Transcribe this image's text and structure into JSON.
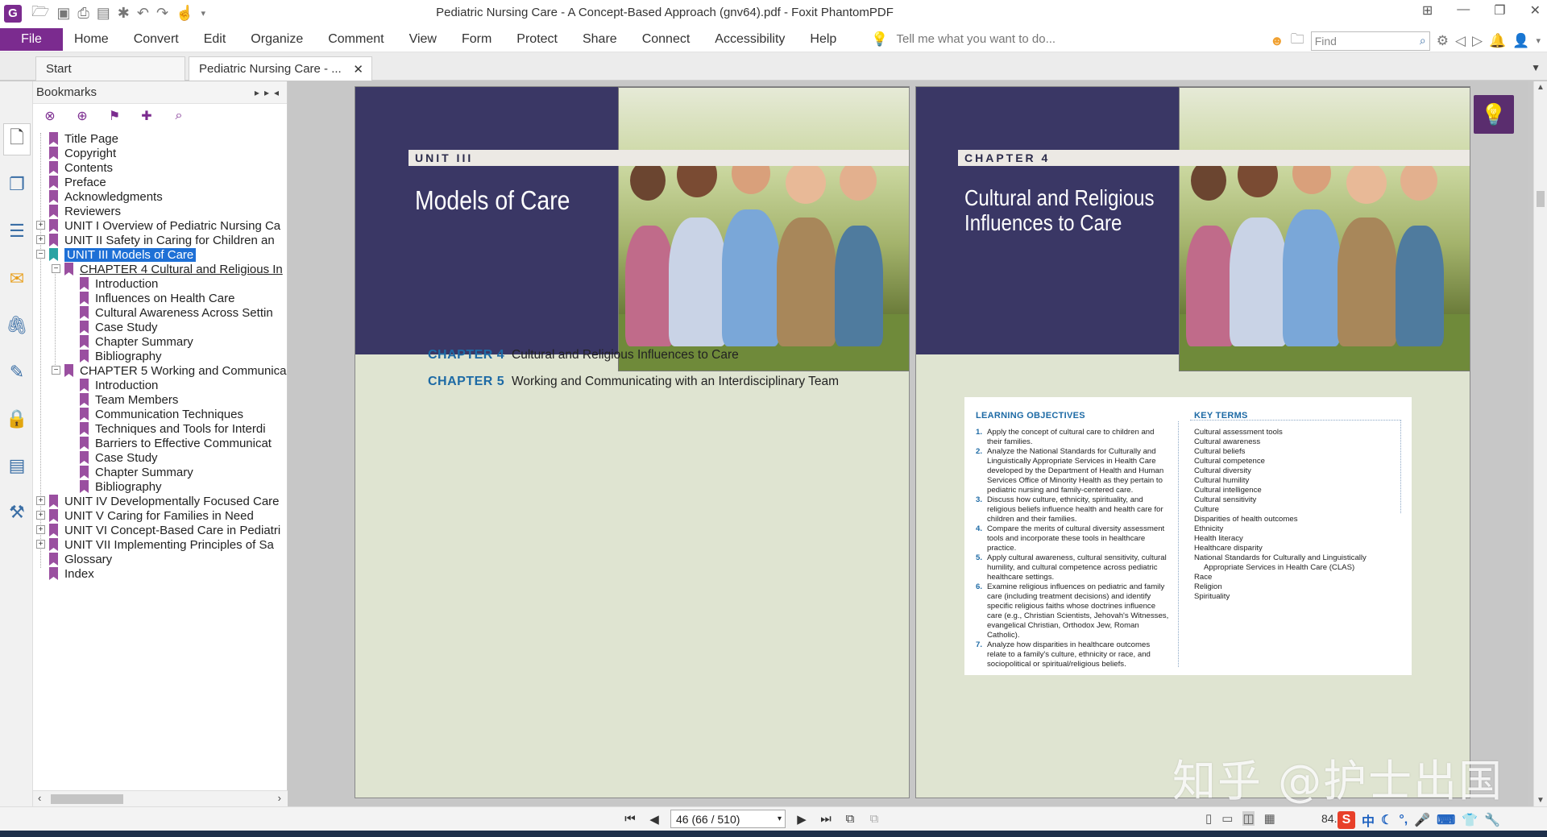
{
  "window": {
    "title": "Pediatric Nursing Care - A Concept-Based Approach (gnv64).pdf - Foxit PhantomPDF"
  },
  "menu": {
    "file": "File",
    "items": [
      "Home",
      "Convert",
      "Edit",
      "Organize",
      "Comment",
      "View",
      "Form",
      "Protect",
      "Share",
      "Connect",
      "Accessibility",
      "Help"
    ],
    "tell_me": "Tell me what you want to do...",
    "find_placeholder": "Find"
  },
  "tabs": [
    {
      "label": "Start"
    },
    {
      "label": "Pediatric Nursing Care - ..."
    }
  ],
  "bookmarks": {
    "header": "Bookmarks",
    "items": [
      {
        "label": "Title Page"
      },
      {
        "label": "Copyright"
      },
      {
        "label": "Contents"
      },
      {
        "label": "Preface"
      },
      {
        "label": "Acknowledgments"
      },
      {
        "label": "Reviewers"
      },
      {
        "label": "UNIT I Overview of Pediatric Nursing Ca"
      },
      {
        "label": "UNIT II Safety in Caring for Children an"
      },
      {
        "label": "UNIT III Models of Care"
      },
      {
        "label": "CHAPTER 4 Cultural and Religious In"
      },
      {
        "label": "Introduction"
      },
      {
        "label": "Influences on Health Care"
      },
      {
        "label": "Cultural Awareness Across Settin"
      },
      {
        "label": "Case Study"
      },
      {
        "label": "Chapter Summary"
      },
      {
        "label": "Bibliography"
      },
      {
        "label": "CHAPTER 5 Working and Communica"
      },
      {
        "label": "Introduction"
      },
      {
        "label": "Team Members"
      },
      {
        "label": "Communication Techniques"
      },
      {
        "label": "Techniques and Tools for Interdi"
      },
      {
        "label": "Barriers to Effective Communicat"
      },
      {
        "label": "Case Study"
      },
      {
        "label": "Chapter Summary"
      },
      {
        "label": "Bibliography"
      },
      {
        "label": "UNIT IV Developmentally Focused Care"
      },
      {
        "label": "UNIT V Caring for Families in Need"
      },
      {
        "label": "UNIT VI Concept-Based Care in Pediatri"
      },
      {
        "label": "UNIT VII Implementing Principles of Sa"
      },
      {
        "label": "Glossary"
      },
      {
        "label": "Index"
      }
    ]
  },
  "left_page": {
    "unit_label": "UNIT III",
    "title": "Models of Care",
    "toc": [
      {
        "chapter": "CHAPTER 4",
        "title": "Cultural and Religious Influences to Care"
      },
      {
        "chapter": "CHAPTER 5",
        "title": "Working and Communicating with an Interdisciplinary Team"
      }
    ]
  },
  "right_page": {
    "chapter_label": "CHAPTER 4",
    "title_line1": "Cultural and Religious",
    "title_line2": "Influences to Care",
    "learning_objectives_title": "LEARNING OBJECTIVES",
    "learning_objectives": [
      {
        "num": "1.",
        "text": "Apply the concept of cultural care to children and their families."
      },
      {
        "num": "2.",
        "text": "Analyze the National Standards for Culturally and Linguistically Appropriate Services in Health Care developed by the Department of Health and Human Services Office of Minority Health as they pertain to pediatric nursing and family-centered care."
      },
      {
        "num": "3.",
        "text": "Discuss how culture, ethnicity, spirituality, and religious beliefs influence health and health care for children and their families."
      },
      {
        "num": "4.",
        "text": "Compare the merits of cultural diversity assessment tools and incorporate these tools in healthcare practice."
      },
      {
        "num": "5.",
        "text": "Apply cultural awareness, cultural sensitivity, cultural humility, and cultural competence across pediatric healthcare settings."
      },
      {
        "num": "6.",
        "text": "Examine religious influences on pediatric and family care (including treatment decisions) and identify specific religious faiths whose doctrines influence care (e.g., Christian Scientists, Jehovah's Witnesses, evangelical Christian, Orthodox Jew, Roman Catholic)."
      },
      {
        "num": "7.",
        "text": "Analyze how disparities in healthcare outcomes relate to a family's culture, ethnicity or race, and sociopolitical or spiritual/religious beliefs."
      }
    ],
    "key_terms_title": "KEY TERMS",
    "key_terms": [
      "Cultural assessment tools",
      "Cultural awareness",
      "Cultural beliefs",
      "Cultural competence",
      "Cultural diversity",
      "Cultural humility",
      "Cultural intelligence",
      "Cultural sensitivity",
      "Culture",
      "Disparities of health outcomes",
      "Ethnicity",
      "Health literacy",
      "Healthcare disparity",
      "National Standards for Culturally and Linguistically Appropriate Services in Health Care (CLAS)",
      "Race",
      "Religion",
      "Spirituality"
    ]
  },
  "status": {
    "page_indicator": "46 (66 / 510)",
    "zoom": "84."
  },
  "watermark": "知乎 @护士出国",
  "colors": {
    "brand": "#7b2b8f",
    "banner": "#3a3765",
    "page_bg": "#dfe4d1",
    "heading_blue": "#1d6aa5",
    "selection": "#1e70d6"
  }
}
